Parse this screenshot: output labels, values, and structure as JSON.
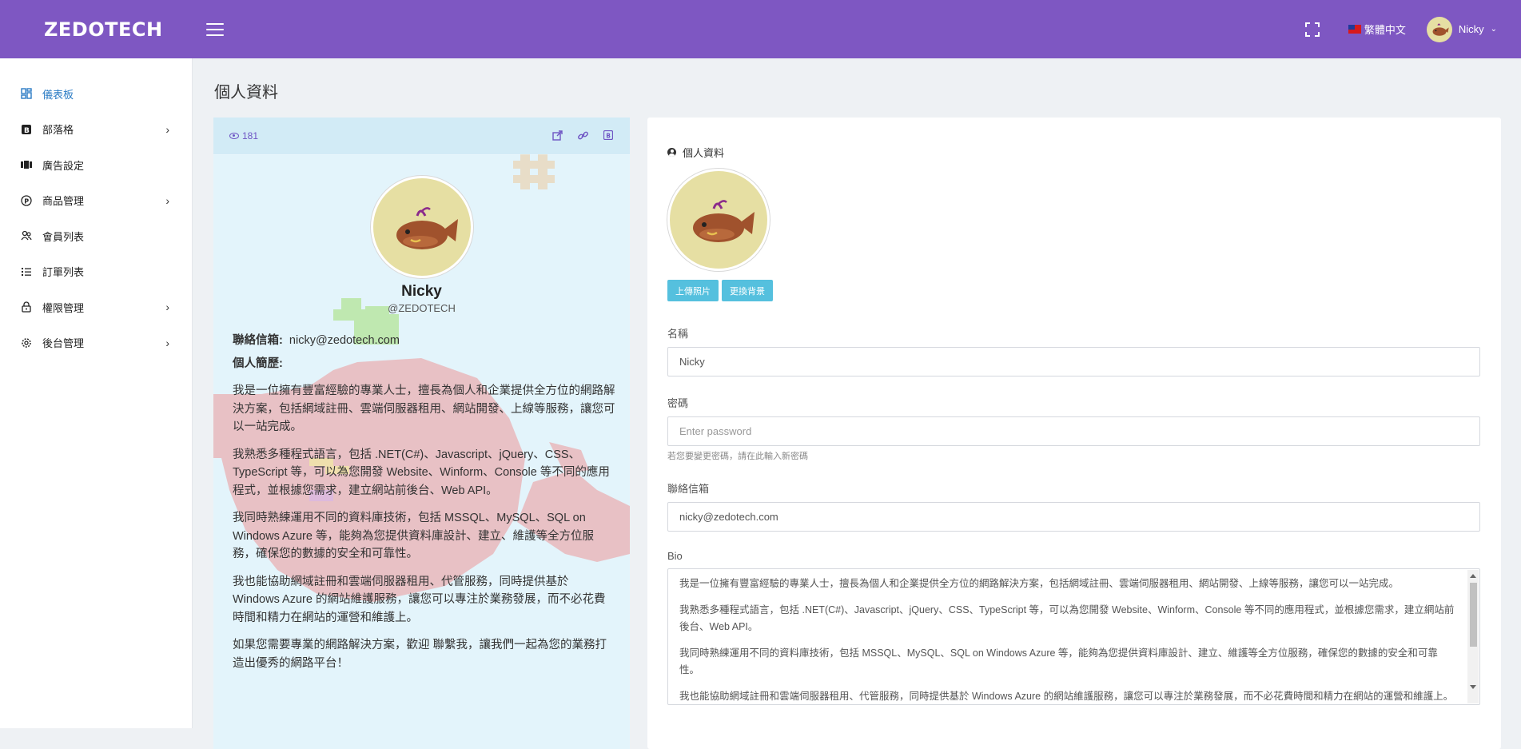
{
  "header": {
    "brand": "ZEDOTECH",
    "language": "繁體中文",
    "username": "Nicky"
  },
  "sidebar": {
    "items": [
      {
        "label": "儀表板",
        "icon": "dashboard-icon",
        "active": true,
        "has_children": false
      },
      {
        "label": "部落格",
        "icon": "blog-icon",
        "active": false,
        "has_children": true
      },
      {
        "label": "廣告設定",
        "icon": "ad-icon",
        "active": false,
        "has_children": false
      },
      {
        "label": "商品管理",
        "icon": "product-icon",
        "active": false,
        "has_children": true
      },
      {
        "label": "會員列表",
        "icon": "members-icon",
        "active": false,
        "has_children": false
      },
      {
        "label": "訂單列表",
        "icon": "orders-icon",
        "active": false,
        "has_children": false
      },
      {
        "label": "權限管理",
        "icon": "lock-icon",
        "active": false,
        "has_children": true
      },
      {
        "label": "後台管理",
        "icon": "gear-icon",
        "active": false,
        "has_children": true
      }
    ]
  },
  "page": {
    "title": "個人資料"
  },
  "profile_card": {
    "views": "181",
    "name": "Nicky",
    "handle": "@ZEDOTECH",
    "email_label": "聯絡信箱:",
    "email": "nicky@zedotech.com",
    "bio_label": "個人簡歷:",
    "bio": [
      "我是一位擁有豐富經驗的專業人士，擅長為個人和企業提供全方位的網路解決方案，包括網域註冊、雲端伺服器租用、網站開發、上線等服務，讓您可以一站完成。",
      "我熟悉多種程式語言，包括 .NET(C#)、Javascript、jQuery、CSS、TypeScript 等，可以為您開發 Website、Winform、Console 等不同的應用程式，並根據您需求，建立網站前後台、Web API。",
      "我同時熟練運用不同的資料庫技術，包括 MSSQL、MySQL、SQL on Windows Azure 等，能夠為您提供資料庫設計、建立、維護等全方位服務，確保您的數據的安全和可靠性。",
      "我也能協助網域註冊和雲端伺服器租用、代管服務，同時提供基於 Windows Azure 的網站維護服務，讓您可以專注於業務發展，而不必花費時間和精力在網站的運營和維護上。",
      "如果您需要專業的網路解決方案，歡迎 聯繫我，讓我們一起為您的業務打造出優秀的網路平台！"
    ]
  },
  "form": {
    "section_title": "個人資料",
    "upload_button": "上傳照片",
    "background_button": "更換背景",
    "name_label": "名稱",
    "name_value": "Nicky",
    "password_label": "密碼",
    "password_placeholder": "Enter password",
    "password_help": "若您要變更密碼，請在此輸入新密碼",
    "email_label": "聯絡信箱",
    "email_value": "nicky@zedotech.com",
    "bio_label": "Bio",
    "bio_paragraphs": [
      "我是一位擁有豐富經驗的專業人士，擅長為個人和企業提供全方位的網路解決方案，包括網域註冊、雲端伺服器租用、網站開發、上線等服務，讓您可以一站完成。",
      "我熟悉多種程式語言，包括 .NET(C#)、Javascript、jQuery、CSS、TypeScript 等，可以為您開發 Website、Winform、Console 等不同的應用程式，並根據您需求，建立網站前後台、Web API。",
      "我同時熟練運用不同的資料庫技術，包括 MSSQL、MySQL、SQL on Windows Azure 等，能夠為您提供資料庫設計、建立、維護等全方位服務，確保您的數據的安全和可靠性。",
      "我也能協助網域註冊和雲端伺服器租用、代管服務，同時提供基於 Windows Azure 的網站維護服務，讓您可以專注於業務發展，而不必花費時間和精力在網站的運營和維護上。"
    ]
  },
  "colors": {
    "header": "#7e57c2",
    "accent_link": "#2a7bc4",
    "button": "#55c0de",
    "card_bg": "#e3f4fb"
  }
}
